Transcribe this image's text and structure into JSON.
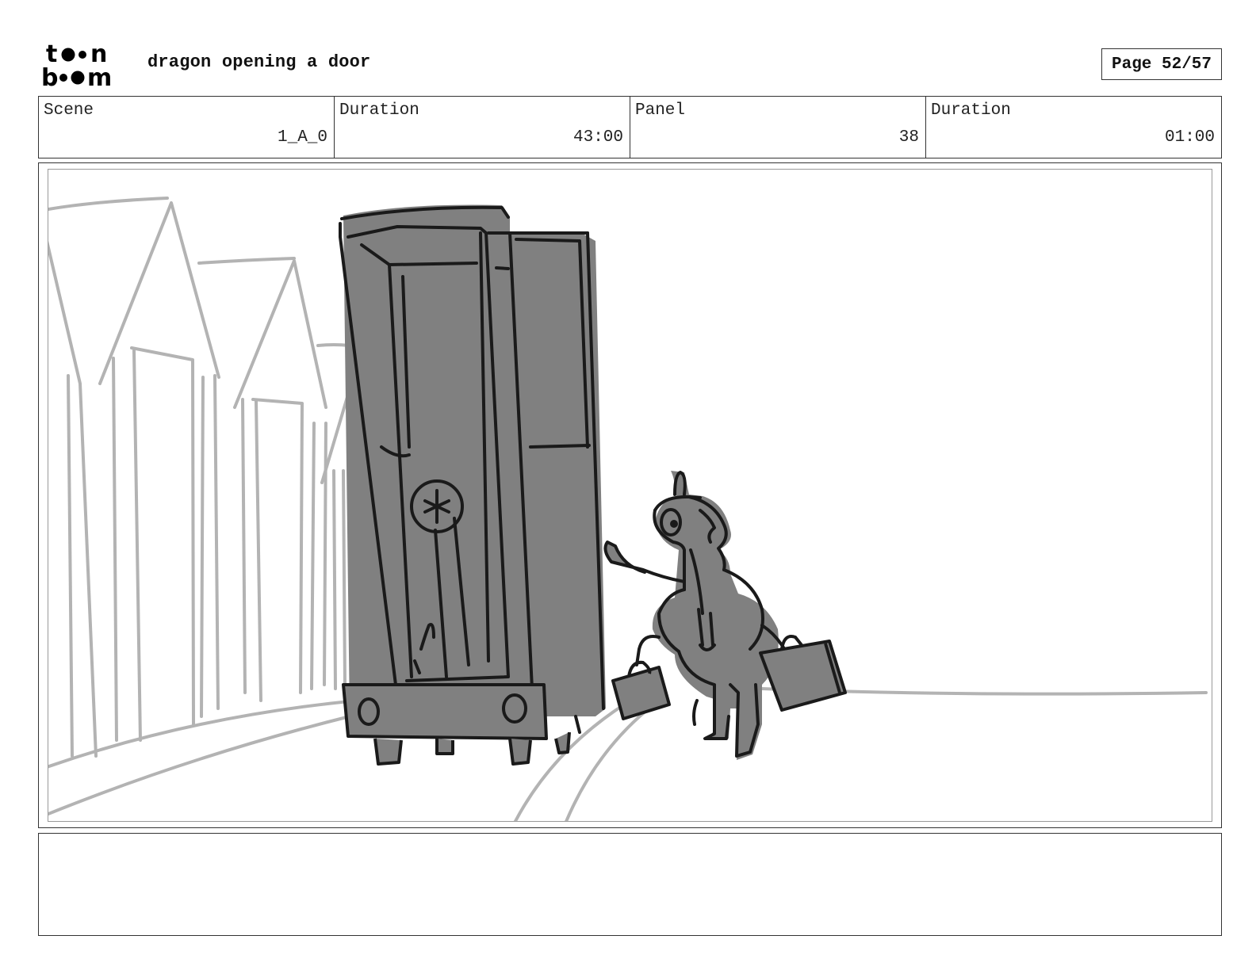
{
  "header": {
    "logo_alt": "toon boom",
    "title": "dragon opening a door",
    "page": "Page 52/57"
  },
  "info": [
    {
      "label": "Scene",
      "value": "1_A_0"
    },
    {
      "label": "Duration",
      "value": "43:00"
    },
    {
      "label": "Panel",
      "value": "38"
    },
    {
      "label": "Duration",
      "value": "01:00"
    }
  ],
  "panel": {
    "image_name": "storyboard-sketch"
  },
  "notes": {
    "text": ""
  },
  "colors": {
    "sketch_fill": "#808080",
    "sketch_line": "#1a1a1a",
    "background_line": "#b3b3b3"
  }
}
